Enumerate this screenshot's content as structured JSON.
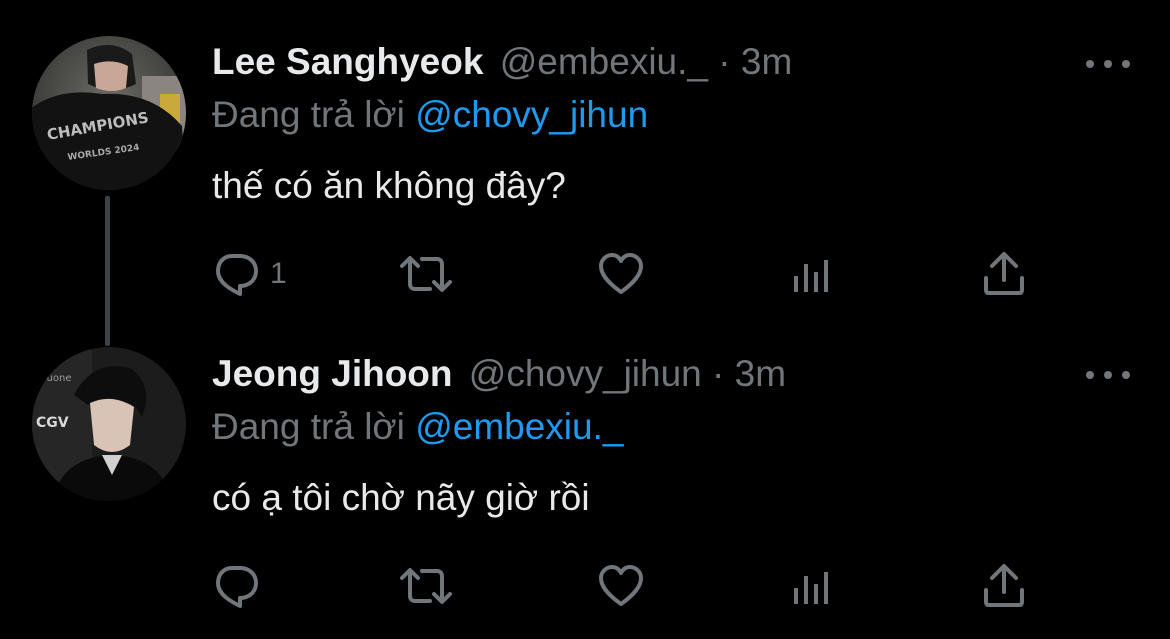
{
  "colors": {
    "background": "#000000",
    "primary_text": "#e7e9ea",
    "secondary_text": "#71767b",
    "link": "#1d9bf0",
    "thread_line": "#3d4247"
  },
  "tweets": [
    {
      "display_name": "Lee Sanghyeok",
      "handle": "@embexiu._",
      "separator": "·",
      "time": "3m",
      "reply_prefix": "Đang trả lời",
      "reply_to": "@chovy_jihun",
      "text": "thế có ăn không đây?",
      "reply_count": "1",
      "avatar": {
        "jacket_text_1": "CHAMPIONS",
        "jacket_text_2": "WORLDS 2024"
      }
    },
    {
      "display_name": "Jeong Jihoon",
      "handle": "@chovy_jihun",
      "separator": "·",
      "time": "3m",
      "reply_prefix": "Đang trả lời",
      "reply_to": "@embexiu._",
      "text": "có ạ tôi chờ nãy giờ rồi",
      "reply_count": "",
      "avatar": {
        "bg_text_1": "CGV",
        "bg_text_2": "imuone"
      }
    }
  ],
  "icons": {
    "reply": "speech-bubble-icon",
    "retweet": "retweet-arrows-icon",
    "like": "heart-icon",
    "views": "bar-chart-icon",
    "share": "share-upload-icon",
    "more": "more-dots-icon"
  }
}
